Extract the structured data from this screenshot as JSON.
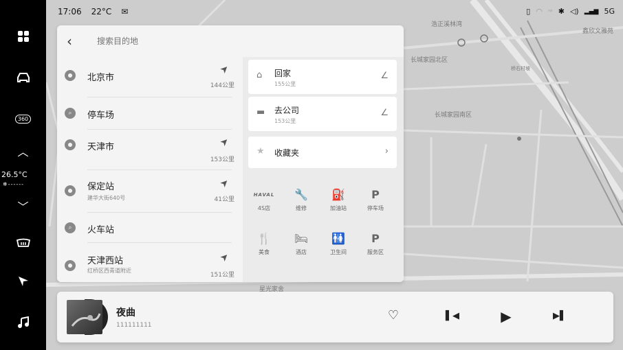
{
  "status_bar": {
    "time": "17:06",
    "temperature": "22°C",
    "mail_icon": "mail-icon",
    "network": "5G",
    "right_icons": [
      "vibrate-icon",
      "wifi-icon",
      "signal-off-icon",
      "bluetooth-icon",
      "volume-icon",
      "signal-icon"
    ]
  },
  "rail": {
    "items": [
      {
        "name": "apps-grid-icon"
      },
      {
        "name": "car-icon"
      },
      {
        "name": "camera-360-icon",
        "label": "360"
      },
      {
        "name": "chevron-up-icon"
      },
      {
        "name": "chevron-down-icon"
      },
      {
        "name": "defrost-icon"
      },
      {
        "name": "navigation-icon"
      },
      {
        "name": "music-icon"
      }
    ],
    "cabin_temp": "26.5°C"
  },
  "search": {
    "placeholder": "搜索目的地"
  },
  "results": [
    {
      "type": "place",
      "name": "北京市",
      "sub": "",
      "distance": "144公里",
      "has_nav": true
    },
    {
      "type": "search",
      "name": "停车场",
      "sub": "",
      "distance": "",
      "has_nav": false
    },
    {
      "type": "place",
      "name": "天津市",
      "sub": "",
      "distance": "153公里",
      "has_nav": true
    },
    {
      "type": "place",
      "name": "保定站",
      "sub": "建华大街640号",
      "distance": "41公里",
      "has_nav": true
    },
    {
      "type": "search",
      "name": "火车站",
      "sub": "",
      "distance": "",
      "has_nav": false
    },
    {
      "type": "place",
      "name": "天津西站",
      "sub": "红桥区西青道附近",
      "distance": "151公里",
      "has_nav": true
    }
  ],
  "shortcuts": {
    "home": {
      "title": "回家",
      "distance": "155公里"
    },
    "work": {
      "title": "去公司",
      "distance": "153公里"
    },
    "favorites": {
      "title": "收藏夹"
    }
  },
  "pois": [
    {
      "icon": "haval-logo",
      "glyph": "HAVAL",
      "label": "4S店"
    },
    {
      "icon": "wrench-icon",
      "glyph": "🔧",
      "label": "维修"
    },
    {
      "icon": "fuel-icon",
      "glyph": "⛽",
      "label": "加油站"
    },
    {
      "icon": "parking-icon",
      "glyph": "P",
      "label": "停车场"
    },
    {
      "icon": "food-icon",
      "glyph": "🍴",
      "label": "美食"
    },
    {
      "icon": "hotel-icon",
      "glyph": "🛏",
      "label": "酒店"
    },
    {
      "icon": "restroom-icon",
      "glyph": "🚻",
      "label": "卫生间"
    },
    {
      "icon": "service-area-icon",
      "glyph": "P",
      "label": "服务区"
    }
  ],
  "map_labels": [
    "长城家园北区",
    "长城家园南区",
    "浩正溪林湾",
    "鑫欣文雅苑",
    "星光家舍",
    "长城家园北区",
    "桥右村坡",
    "北京市"
  ],
  "media": {
    "title": "夜曲",
    "artist": "111111111",
    "favorite_icon": "heart-icon",
    "prev_icon": "previous-track-icon",
    "play_icon": "play-icon",
    "next_icon": "next-track-icon"
  }
}
